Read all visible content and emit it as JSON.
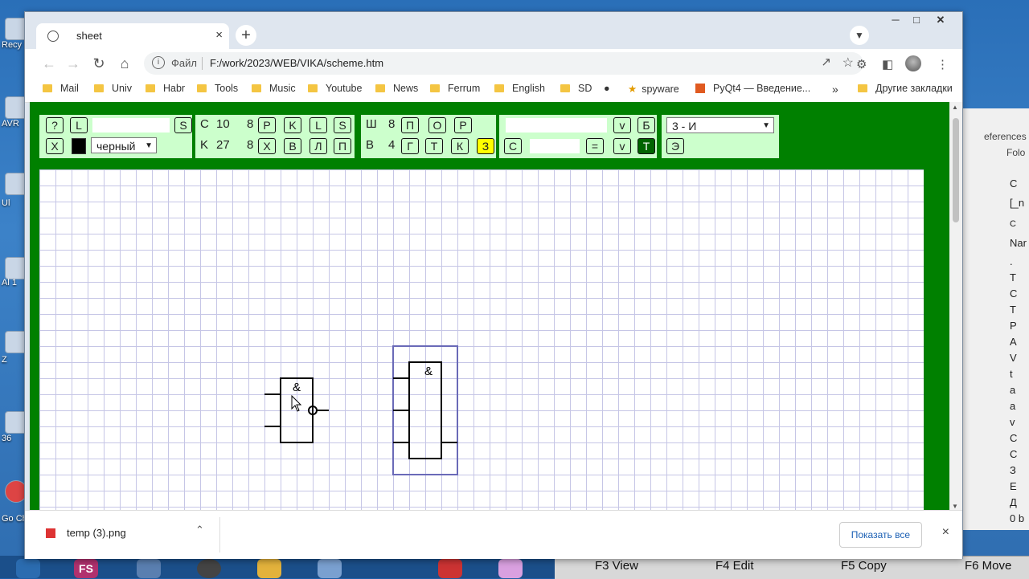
{
  "desktop": {
    "labels": [
      "Recy",
      "AVR",
      "Ul",
      "Al 1",
      "Z",
      "36",
      "Go Ch"
    ]
  },
  "browser": {
    "tab": {
      "title": "sheet",
      "close": "×"
    },
    "new_tab": "+",
    "address": {
      "proto": "Файл",
      "url": "F:/work/2023/WEB/VIKA/scheme.htm"
    },
    "bookmarks": [
      {
        "label": "Mail",
        "type": "folder"
      },
      {
        "label": "Univ",
        "type": "folder"
      },
      {
        "label": "Habr",
        "type": "folder"
      },
      {
        "label": "Tools",
        "type": "folder"
      },
      {
        "label": "Music",
        "type": "folder"
      },
      {
        "label": "Youtube",
        "type": "folder"
      },
      {
        "label": "News",
        "type": "folder"
      },
      {
        "label": "Ferrum",
        "type": "folder"
      },
      {
        "label": "English",
        "type": "folder"
      },
      {
        "label": "SD",
        "type": "folder"
      },
      {
        "label": "spyware",
        "type": "star"
      },
      {
        "label": "PyQt4 — Введение...",
        "type": "page"
      }
    ],
    "bookmarks_more": "»",
    "bookmarks_other": "Другие закладки"
  },
  "app": {
    "panel1": {
      "row1": {
        "help": "?",
        "l": "L",
        "s": "S"
      },
      "row2": {
        "x": "X",
        "color_select": "черный",
        "swatch_color": "#000000"
      }
    },
    "panel2": {
      "row1": {
        "label": "C",
        "v1": "10",
        "v2": "8",
        "b1": "P",
        "b2": "K",
        "b3": "L",
        "b4": "S"
      },
      "row2": {
        "label": "K",
        "v1": "27",
        "v2": "8",
        "b1": "X",
        "b2": "В",
        "b3": "Л",
        "b4": "П"
      }
    },
    "panel3": {
      "row1": {
        "label": "Ш",
        "v1": "8",
        "b1": "П",
        "b2": "О",
        "b3": "Р"
      },
      "row2": {
        "label": "В",
        "v1": "4",
        "b1": "Г",
        "b2": "Т",
        "b3": "К",
        "b4": "З"
      }
    },
    "panel4": {
      "row1": {
        "b1": "v",
        "b2": "Б"
      },
      "row2": {
        "b1": "С",
        "b2": "=",
        "b3": "v",
        "b4": "T"
      }
    },
    "panel5": {
      "select": "3 - И",
      "b1": "Э"
    },
    "gate_symbol": "&",
    "colors": {
      "page_bg": "#008000",
      "panel_bg": "#ccffcc",
      "highlight_yellow": "#ffff00",
      "active_green": "#006400",
      "grid": "#c6c6e6"
    }
  },
  "downloads": {
    "file": "temp (3).png",
    "show_all": "Показать все",
    "close": "×"
  },
  "bgapp": {
    "rows": [
      "eferences",
      "Folo",
      "C",
      "[_n",
      "C",
      "Nar",
      ".",
      "T",
      "C",
      "T",
      "P",
      "A",
      "V",
      "t",
      "a",
      "a",
      "v",
      "C",
      "C",
      "З",
      "E",
      "Д",
      "0 b"
    ]
  },
  "taskbar": {
    "fkeys": [
      "F3 View",
      "F4 Edit",
      "F5 Copy",
      "F6 Move"
    ],
    "icon_label": "FS"
  }
}
